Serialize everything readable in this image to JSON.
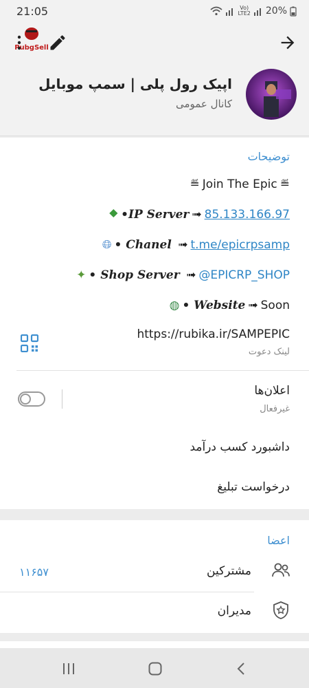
{
  "status": {
    "time": "21:05",
    "battery": "20%",
    "network_label": "Vo)\nLTE2"
  },
  "logo_text": "PubgSell",
  "channel": {
    "title": "اپیک رول پلی | سمپ موبایل",
    "subtitle": "کانال عمومی"
  },
  "description": {
    "section_title": "توضیحات",
    "join_line": "Join The Epic",
    "ip_label": "•IP Server",
    "ip_value": "85.133.166.97",
    "chanel_label": "• Chanel",
    "chanel_value": "t.me/epicrpsamp",
    "shop_label": "• Shop Server",
    "shop_value": "@EPICRP_SHOP",
    "website_label": "• Website",
    "website_value": "Soon"
  },
  "invite": {
    "link": "https://rubika.ir/SAMPEPIC",
    "label": "لینک دعوت"
  },
  "notifications": {
    "label": "اعلان‌ها",
    "state": "غیرفعال",
    "enabled": false
  },
  "menu": {
    "dashboard": "داشبورد کسب درآمد",
    "ad_request": "درخواست تبلیغ"
  },
  "members": {
    "section_title": "اعضا",
    "subscribers_label": "مشترکین",
    "subscribers_count": "۱۱۶۵۷",
    "admins_label": "مدیران"
  },
  "colors": {
    "accent": "#3e8fd0",
    "link": "#2f86c6"
  },
  "icons": [
    "kebab-menu-icon",
    "pencil-icon",
    "arrow-forward-icon",
    "qr-code-icon",
    "people-icon",
    "shield-star-icon"
  ]
}
